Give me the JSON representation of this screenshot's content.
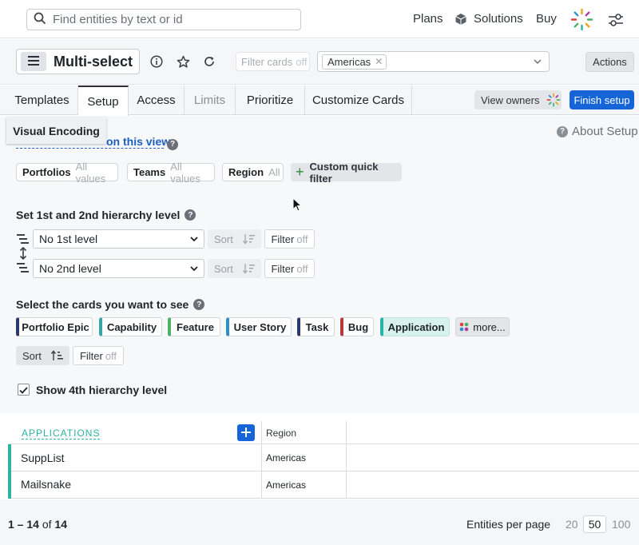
{
  "topbar": {
    "search_placeholder": "Find entities by text or id",
    "links": [
      "Plans",
      "Solutions",
      "Buy"
    ]
  },
  "view": {
    "title": "Multi-select",
    "filter_cards_label": "Filter cards",
    "filter_cards_state": "off",
    "region_tag": "Americas",
    "actions_label": "Actions"
  },
  "tabs": [
    {
      "label": "Templates",
      "active": false,
      "muted": false
    },
    {
      "label": "Setup",
      "active": true,
      "muted": false
    },
    {
      "label": "Access",
      "active": false,
      "muted": false
    },
    {
      "label": "Limits",
      "active": false,
      "muted": true
    },
    {
      "label": "Prioritize",
      "active": false,
      "muted": false
    },
    {
      "label": "Customize Cards",
      "active": false,
      "muted": false
    }
  ],
  "header_buttons": {
    "view_owners": "View owners",
    "finish_setup": "Finish setup"
  },
  "setup": {
    "tooltip": "Visual Encoding",
    "partial_link": "on this view",
    "about": "About Setup",
    "quick_filters": [
      {
        "name": "Portfolios",
        "value": "All values"
      },
      {
        "name": "Teams",
        "value": "All values"
      },
      {
        "name": "Region",
        "value": "All"
      }
    ],
    "custom_quick_filter": "Custom quick filter",
    "hierarchy_title": "Set 1st and 2nd hierarchy level",
    "level1": "No 1st level",
    "level2": "No 2nd level",
    "sort_label": "Sort",
    "filter_label": "Filter",
    "filter_state": "off",
    "cards_title": "Select the cards you want to see",
    "cards": [
      {
        "label": "Portfolio Epic",
        "color": "#2b3a67"
      },
      {
        "label": "Capability",
        "color": "#3aa4a4"
      },
      {
        "label": "Feature",
        "color": "#4caf6a"
      },
      {
        "label": "User Story",
        "color": "#2f8fc9"
      },
      {
        "label": "Task",
        "color": "#2b3a67"
      },
      {
        "label": "Bug",
        "color": "#b23a3a"
      },
      {
        "label": "Application",
        "color": "#2ab3a6"
      }
    ],
    "more_label": "more...",
    "show_4th": "Show 4th hierarchy level",
    "show_4th_checked": true
  },
  "table": {
    "group_label": "APPLICATIONS",
    "columns": [
      "Region"
    ],
    "rows": [
      {
        "name": "SuppList",
        "region": "Americas"
      },
      {
        "name": "Mailsnake",
        "region": "Americas"
      }
    ]
  },
  "footer": {
    "range": "1 – 14",
    "of_label": "of",
    "total": "14",
    "per_page_label": "Entities per page",
    "page_sizes": [
      "20",
      "50",
      "100"
    ],
    "selected_page_size": "50"
  },
  "colors": {
    "accent": "#1565d8",
    "teal": "#2ab3a6"
  }
}
